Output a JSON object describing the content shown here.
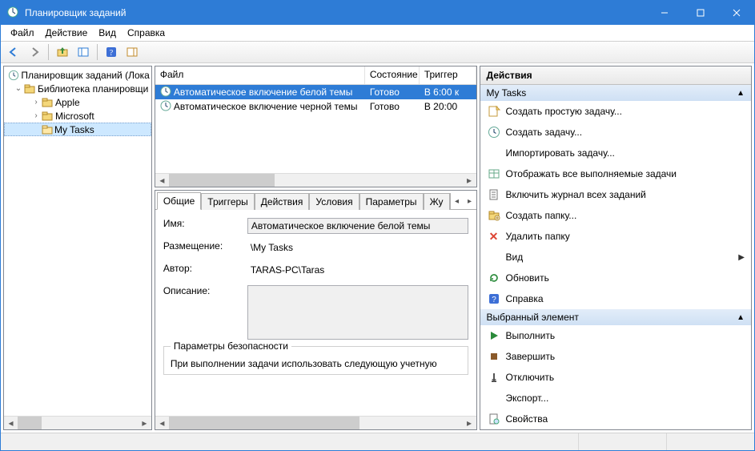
{
  "window": {
    "title": "Планировщик заданий"
  },
  "menu": {
    "file": "Файл",
    "action": "Действие",
    "view": "Вид",
    "help": "Справка"
  },
  "toolbar_icons": {
    "back": "back-arrow",
    "forward": "forward-arrow",
    "up": "up-folder",
    "props": "properties",
    "help": "help",
    "extra": "panels"
  },
  "tree": {
    "root": "Планировщик заданий (Лока",
    "library": "Библиотека планировщи",
    "items": [
      "Apple",
      "Microsoft",
      "My Tasks"
    ]
  },
  "task_columns": {
    "file": "Файл",
    "state": "Состояние",
    "trigger": "Триггер"
  },
  "tasks": [
    {
      "name": "Автоматическое включение белой темы",
      "state": "Готово",
      "trigger": "В 6:00 к"
    },
    {
      "name": "Автоматическое включение черной темы",
      "state": "Готово",
      "trigger": "В 20:00"
    }
  ],
  "tabs": {
    "general": "Общие",
    "triggers": "Триггеры",
    "actions": "Действия",
    "conditions": "Условия",
    "settings": "Параметры",
    "journal": "Жу"
  },
  "details": {
    "name_label": "Имя:",
    "name_value": "Автоматическое включение белой темы",
    "location_label": "Размещение:",
    "location_value": "\\My Tasks",
    "author_label": "Автор:",
    "author_value": "TARAS-PC\\Taras",
    "description_label": "Описание:",
    "security_group": "Параметры безопасности",
    "security_line": "При выполнении задачи использовать следующую учетную"
  },
  "actions_pane": {
    "title": "Действия",
    "section1": "My Tasks",
    "items1": [
      {
        "icon": "wizard",
        "label": "Создать простую задачу..."
      },
      {
        "icon": "clock",
        "label": "Создать задачу..."
      },
      {
        "icon": "none",
        "label": "Импортировать задачу..."
      },
      {
        "icon": "table",
        "label": "Отображать все выполняемые задачи"
      },
      {
        "icon": "log",
        "label": "Включить журнал всех заданий"
      },
      {
        "icon": "newfolder",
        "label": "Создать папку..."
      },
      {
        "icon": "deletex",
        "label": "Удалить папку"
      },
      {
        "icon": "none",
        "label": "Вид",
        "chevron": true
      },
      {
        "icon": "refresh",
        "label": "Обновить"
      },
      {
        "icon": "helpq",
        "label": "Справка"
      }
    ],
    "section2": "Выбранный элемент",
    "items2": [
      {
        "icon": "run",
        "label": "Выполнить"
      },
      {
        "icon": "stop",
        "label": "Завершить"
      },
      {
        "icon": "disable",
        "label": "Отключить"
      },
      {
        "icon": "none",
        "label": "Экспорт..."
      },
      {
        "icon": "props",
        "label": "Свойства"
      }
    ]
  }
}
